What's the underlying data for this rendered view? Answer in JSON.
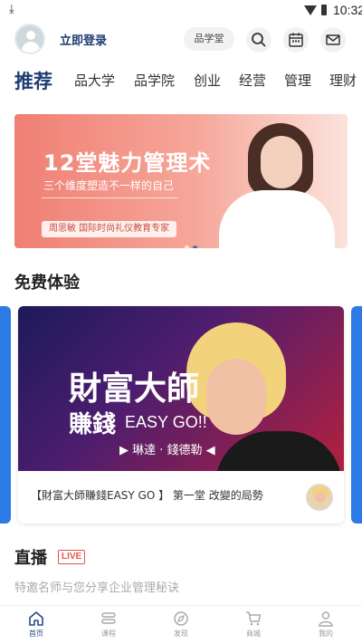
{
  "status_bar": {
    "time": "10:32",
    "download_glyph": "⤓"
  },
  "header": {
    "login_label": "立即登录",
    "pill_label": "品学堂",
    "icons": [
      "search-icon",
      "calendar-icon",
      "mail-icon"
    ]
  },
  "category_tabs": [
    "推荐",
    "品大学",
    "品学院",
    "创业",
    "经营",
    "管理",
    "理财"
  ],
  "banner": {
    "title": "12堂魅力管理术",
    "subtitle": "三个维度塑造不一样的自己",
    "tagline": "周思敏 国际时尚礼仪教育专家"
  },
  "free_section": {
    "title": "免费体验",
    "card": {
      "image_title_1": "財富大師",
      "image_title_2": "賺錢",
      "image_title_3": "EASY GO!!",
      "image_subtitle": "▶ 琳達 · 錢德勒 ◀",
      "caption": "【財富大師賺錢EASY GO 】 第一堂 改變的局勢"
    }
  },
  "live_section": {
    "title": "直播",
    "badge": "LIVE",
    "description": "特邀名师与您分享企业管理秘诀"
  },
  "bottom_nav": {
    "items": [
      {
        "label": "首页",
        "icon": "home-icon",
        "active": true
      },
      {
        "label": "课程",
        "icon": "course-icon",
        "active": false
      },
      {
        "label": "发现",
        "icon": "discover-icon",
        "active": false
      },
      {
        "label": "商城",
        "icon": "cart-icon",
        "active": false
      },
      {
        "label": "我的",
        "icon": "profile-icon",
        "active": false
      }
    ]
  },
  "colors": {
    "accent": "#1d3c72",
    "live": "#e2574c",
    "side_card": "#2c7be5"
  }
}
